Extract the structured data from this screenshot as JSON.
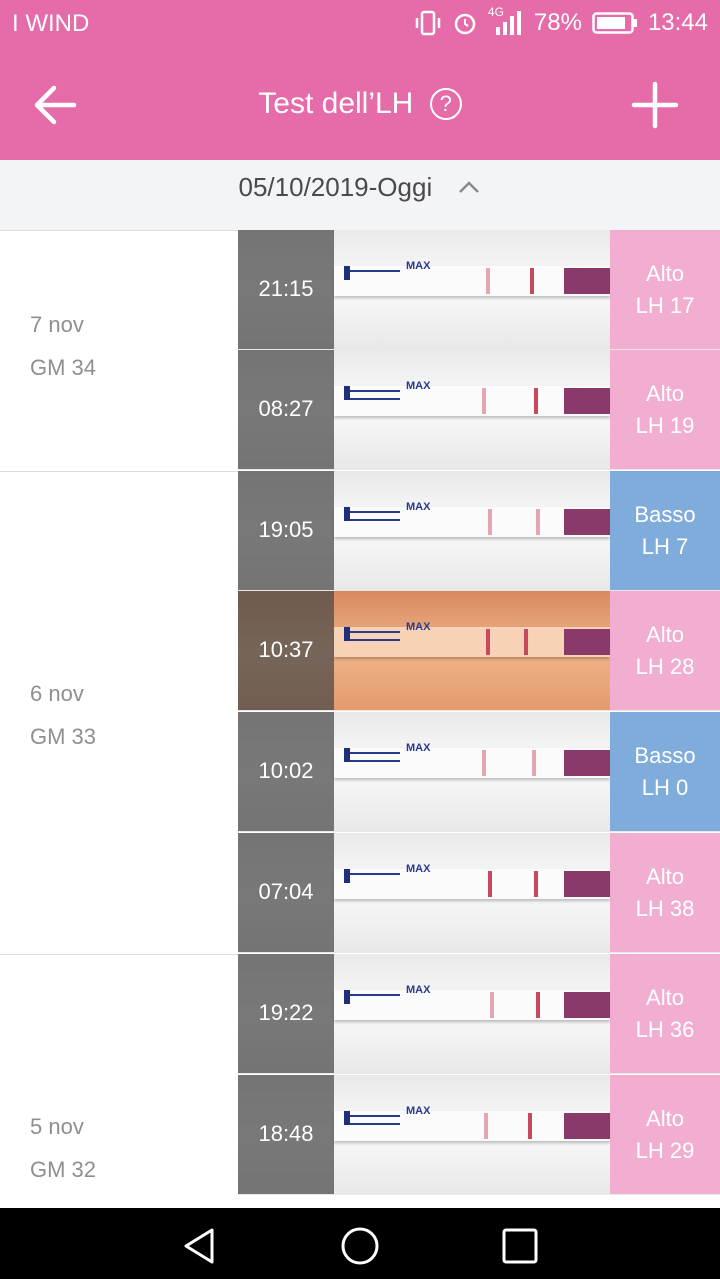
{
  "status": {
    "carrier": "I WIND",
    "network": "4G",
    "battery": "78%",
    "time": "13:44"
  },
  "appbar": {
    "title": "Test dell’LH",
    "help_symbol": "?"
  },
  "datebar": {
    "range": "05/10/2019-Oggi"
  },
  "strip_text": {
    "max": "MAX"
  },
  "days": [
    {
      "date": "7 nov",
      "gm": "GM 34",
      "tests": [
        {
          "time": "21:15",
          "level": "Alto",
          "value": "LH 17"
        },
        {
          "time": "08:27",
          "level": "Alto",
          "value": "LH 19"
        }
      ]
    },
    {
      "date": "6 nov",
      "gm": "GM 33",
      "tests": [
        {
          "time": "19:05",
          "level": "Basso",
          "value": "LH 7"
        },
        {
          "time": "10:37",
          "level": "Alto",
          "value": "LH 28"
        },
        {
          "time": "10:02",
          "level": "Basso",
          "value": "LH 0"
        },
        {
          "time": "07:04",
          "level": "Alto",
          "value": "LH 38"
        }
      ]
    },
    {
      "date": "5 nov",
      "gm": "GM 32",
      "tests": [
        {
          "time": "19:22",
          "level": "Alto",
          "value": "LH 36"
        },
        {
          "time": "18:48",
          "level": "Alto",
          "value": "LH 29"
        }
      ]
    }
  ],
  "colors": {
    "brand": "#e56ba9",
    "high": "#f0a0c8",
    "low": "#6ea0d7"
  }
}
